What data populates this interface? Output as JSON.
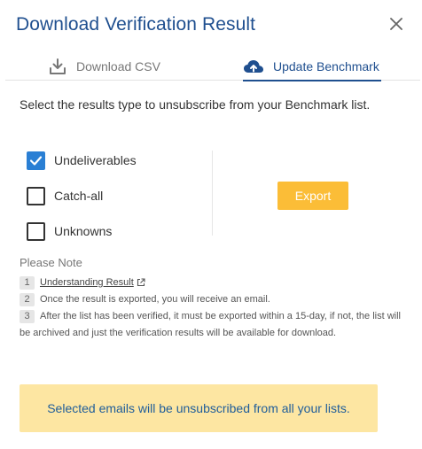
{
  "dialog": {
    "title": "Download Verification Result"
  },
  "tabs": [
    {
      "label": "Download CSV",
      "icon": "download-icon",
      "active": false
    },
    {
      "label": "Update Benchmark",
      "icon": "cloud-upload-icon",
      "active": true
    }
  ],
  "instruction": "Select the results type to unsubscribe from your Benchmark list.",
  "options": [
    {
      "label": "Undeliverables",
      "checked": true
    },
    {
      "label": "Catch-all",
      "checked": false
    },
    {
      "label": "Unknowns",
      "checked": false
    }
  ],
  "export_label": "Export",
  "note": {
    "title": "Please Note",
    "items": [
      {
        "num": "1",
        "text": "Understanding Result"
      },
      {
        "num": "2",
        "text": "Once the result is exported, you will receive an email."
      },
      {
        "num": "3",
        "text": "After the list has been verified, it must be exported within a 15-day, if not, the list will be archived and just the verification results will be available for download."
      }
    ]
  },
  "alert": "Selected emails will be unsubscribed from all your lists.",
  "colors": {
    "primary": "#1f4f8f",
    "checkbox": "#2a7fd4",
    "export_button": "#fbbd37",
    "alert_bg": "#fde6a2"
  }
}
